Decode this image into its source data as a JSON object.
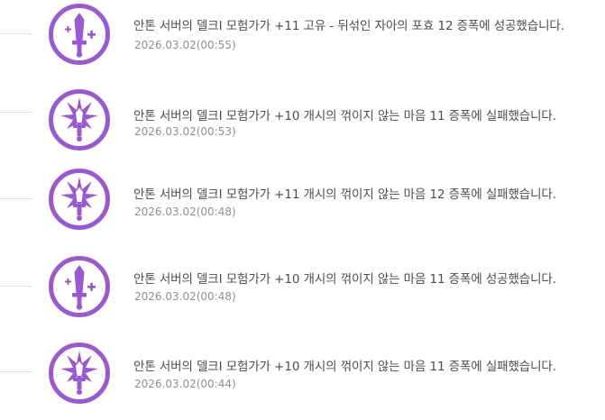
{
  "accent_color": "#9b59d0",
  "entries": [
    {
      "icon": "sword-success-icon",
      "message": "안톤 서버의 델크I 모험가가 +11 고유 - 뒤섞인 자아의 포효 12 증폭에 성공했습니다.",
      "timestamp": "2026.03.02(00:55)"
    },
    {
      "icon": "sword-broken-icon",
      "message": "안톤 서버의 델크I 모험가가 +10 개시의 꺾이지 않는 마음 11 증폭에 실패했습니다.",
      "timestamp": "2026.03.02(00:53)"
    },
    {
      "icon": "sword-broken-icon",
      "message": "안톤 서버의 델크I 모험가가 +11 개시의 꺾이지 않는 마음 12 증폭에 실패했습니다.",
      "timestamp": "2026.03.02(00:48)"
    },
    {
      "icon": "sword-success-icon",
      "message": "안톤 서버의 델크I 모험가가 +10 개시의 꺾이지 않는 마음 11 증폭에 성공했습니다.",
      "timestamp": "2026.03.02(00:48)"
    },
    {
      "icon": "sword-broken-icon",
      "message": "안톤 서버의 델크I 모험가가 +10 개시의 꺾이지 않는 마음 11 증폭에 실패했습니다.",
      "timestamp": "2026.03.02(00:44)"
    }
  ]
}
